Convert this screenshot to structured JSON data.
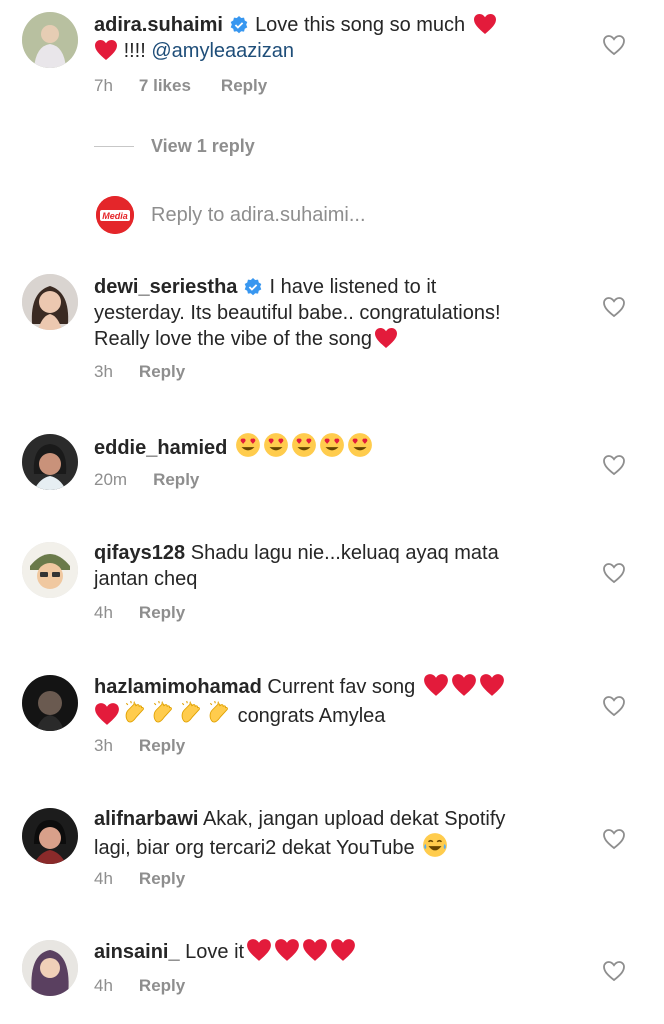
{
  "comments": [
    {
      "user": "adira.suhaimi",
      "verified": true,
      "text1": "Love this song so much",
      "text2": "!!!!",
      "mention": "@amyleaazizan",
      "time": "7h",
      "likes": "7 likes",
      "reply": "Reply"
    },
    {
      "user": "dewi_seriestha",
      "verified": true,
      "text1": "I have listened to it",
      "text2": "yesterday. Its beautiful babe.. congratulations!",
      "text3": "Really love the vibe of the song",
      "time": "3h",
      "reply": "Reply"
    },
    {
      "user": "eddie_hamied",
      "text1": "",
      "time": "20m",
      "reply": "Reply"
    },
    {
      "user": "qifays128",
      "text1": "Shadu lagu nie...keluaq ayaq mata",
      "text2": "jantan cheq",
      "time": "4h",
      "reply": "Reply"
    },
    {
      "user": "hazlamimohamad",
      "text1": "Current fav song",
      "text2": "congrats Amylea",
      "time": "3h",
      "reply": "Reply"
    },
    {
      "user": "alifnarbawi",
      "text1": "Akak, jangan upload dekat Spotify",
      "text2": "lagi, biar org tercari2 dekat YouTube",
      "time": "4h",
      "reply": "Reply"
    },
    {
      "user": "ainsaini_",
      "text1": "Love it",
      "time": "4h",
      "reply": "Reply"
    }
  ],
  "view_replies": "View 1 reply",
  "reply_placeholder": "Reply to adira.suhaimi...",
  "reply_avatar_label": "Media",
  "colors": {
    "heart": "#e0245e",
    "verified": "#3897f0",
    "muted": "#8e8e8e"
  }
}
